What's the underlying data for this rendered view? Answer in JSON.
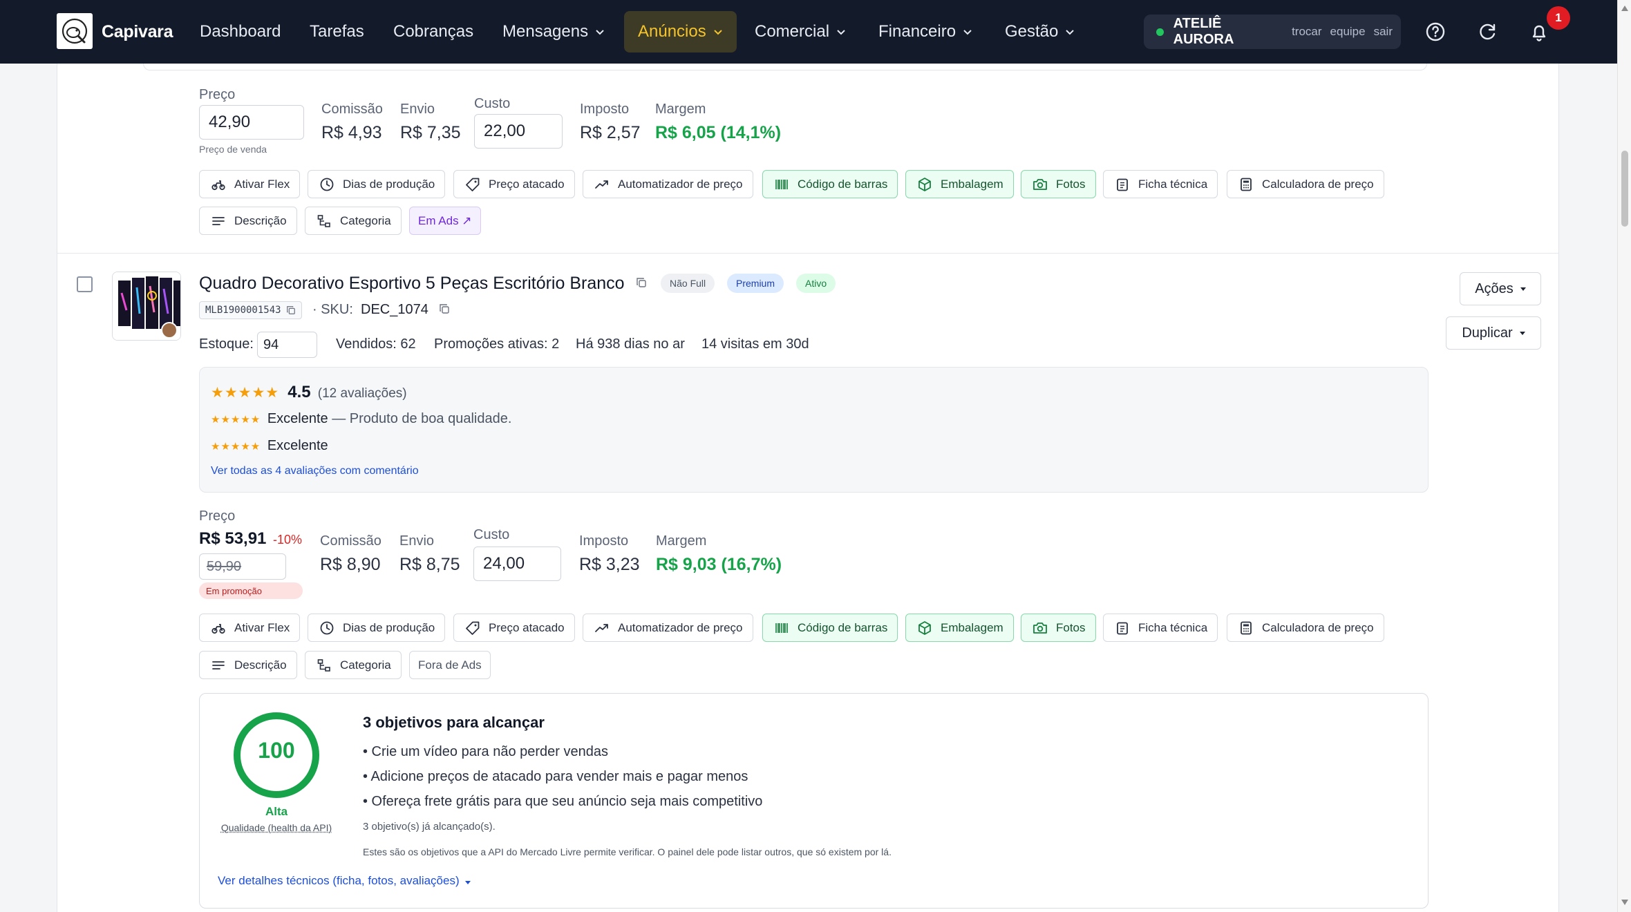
{
  "nav": {
    "brand": "Capivara",
    "items": [
      "Dashboard",
      "Tarefas",
      "Cobranças",
      "Mensagens",
      "Anúncios",
      "Comercial",
      "Financeiro",
      "Gestão"
    ],
    "active": "Anúncios",
    "store": {
      "name": "ATELIÊ AURORA",
      "links": [
        "trocar",
        "equipe",
        "sair"
      ],
      "status_color": "#22c55e"
    },
    "notification_count": "1",
    "accent_color": "#f5c42c"
  },
  "prev_listing": {
    "price_label": "Preço",
    "price_value": "42,90",
    "price_note": "Preço de venda",
    "commission_label": "Comissão",
    "commission_value": "R$ 4,93",
    "shipping_label": "Envio",
    "shipping_value": "R$ 7,35",
    "cost_label": "Custo",
    "cost_value": "22,00",
    "tax_label": "Imposto",
    "tax_value": "R$ 2,57",
    "margin_label": "Margem",
    "margin_value": "R$ 6,05",
    "margin_pct": "(14,1%)",
    "ads_label": "Em Ads ↗"
  },
  "tools": {
    "flex": "Ativar Flex",
    "production_days": "Dias de produção",
    "wholesale": "Preço atacado",
    "price_automator": "Automatizador de preço",
    "barcode": "Código de barras",
    "packaging": "Embalagem",
    "photos": "Fotos",
    "datasheet": "Ficha técnica",
    "price_calculator": "Calculadora de preço",
    "description": "Descrição",
    "category": "Categoria"
  },
  "listing": {
    "title": "Quadro Decorativo Esportivo 5 Peças Escritório Branco",
    "chips": {
      "full": "Não Full",
      "type": "Premium",
      "status": "Ativo"
    },
    "mlb": "MLB1900001543",
    "sku_label": "· SKU:",
    "sku_value": "DEC_1074",
    "stock_label": "Estoque:",
    "stock_value": "94",
    "sold": "Vendidos: 62",
    "promos": "Promoções ativas: 2",
    "days_live": "Há 938 dias no ar",
    "visits": "14 visitas em 30d",
    "actions_label": "Ações",
    "duplicate_label": "Duplicar",
    "reviews": {
      "rating": "4.5",
      "rating_stars": 4.5,
      "count": "(12 avaliações)",
      "items": [
        {
          "stars": "★★★★★",
          "title": "Excelente",
          "comment": "— Produto de boa qualidade."
        },
        {
          "stars": "★★★★★",
          "title": "Excelente",
          "comment": ""
        }
      ],
      "see_all": "Ver todas as 4 avaliações com comentário"
    },
    "price_label": "Preço",
    "price_value": "R$ 53,91",
    "discount": "-10%",
    "original_price": "59,90",
    "promo_tag": "Em promoção",
    "commission_label": "Comissão",
    "commission_value": "R$ 8,90",
    "shipping_label": "Envio",
    "shipping_value": "R$ 8,75",
    "cost_label": "Custo",
    "cost_value": "24,00",
    "tax_label": "Imposto",
    "tax_value": "R$ 3,23",
    "margin_label": "Margem",
    "margin_value": "R$ 9,03",
    "margin_pct": "(16,7%)",
    "ads_label": "Fora de Ads"
  },
  "quality": {
    "score": "100",
    "score_fraction": 1.0,
    "level": "Alta",
    "caption": "Qualidade (health da API)",
    "heading": "3 objetivos para alcançar",
    "goals": [
      "• Crie um vídeo para não perder vendas",
      "• Adicione preços de atacado para vender mais e pagar menos",
      "• Ofereça frete grátis para que seu anúncio seja mais competitivo"
    ],
    "achieved": "3 objetivo(s) já alcançado(s).",
    "disclaimer": "Estes são os objetivos que a API do Mercado Livre permite verificar. O painel dele pode listar outros, que só existem por lá.",
    "details_link": "Ver detalhes técnicos (ficha, fotos, avaliações)",
    "ring_color": "#16a34a"
  }
}
